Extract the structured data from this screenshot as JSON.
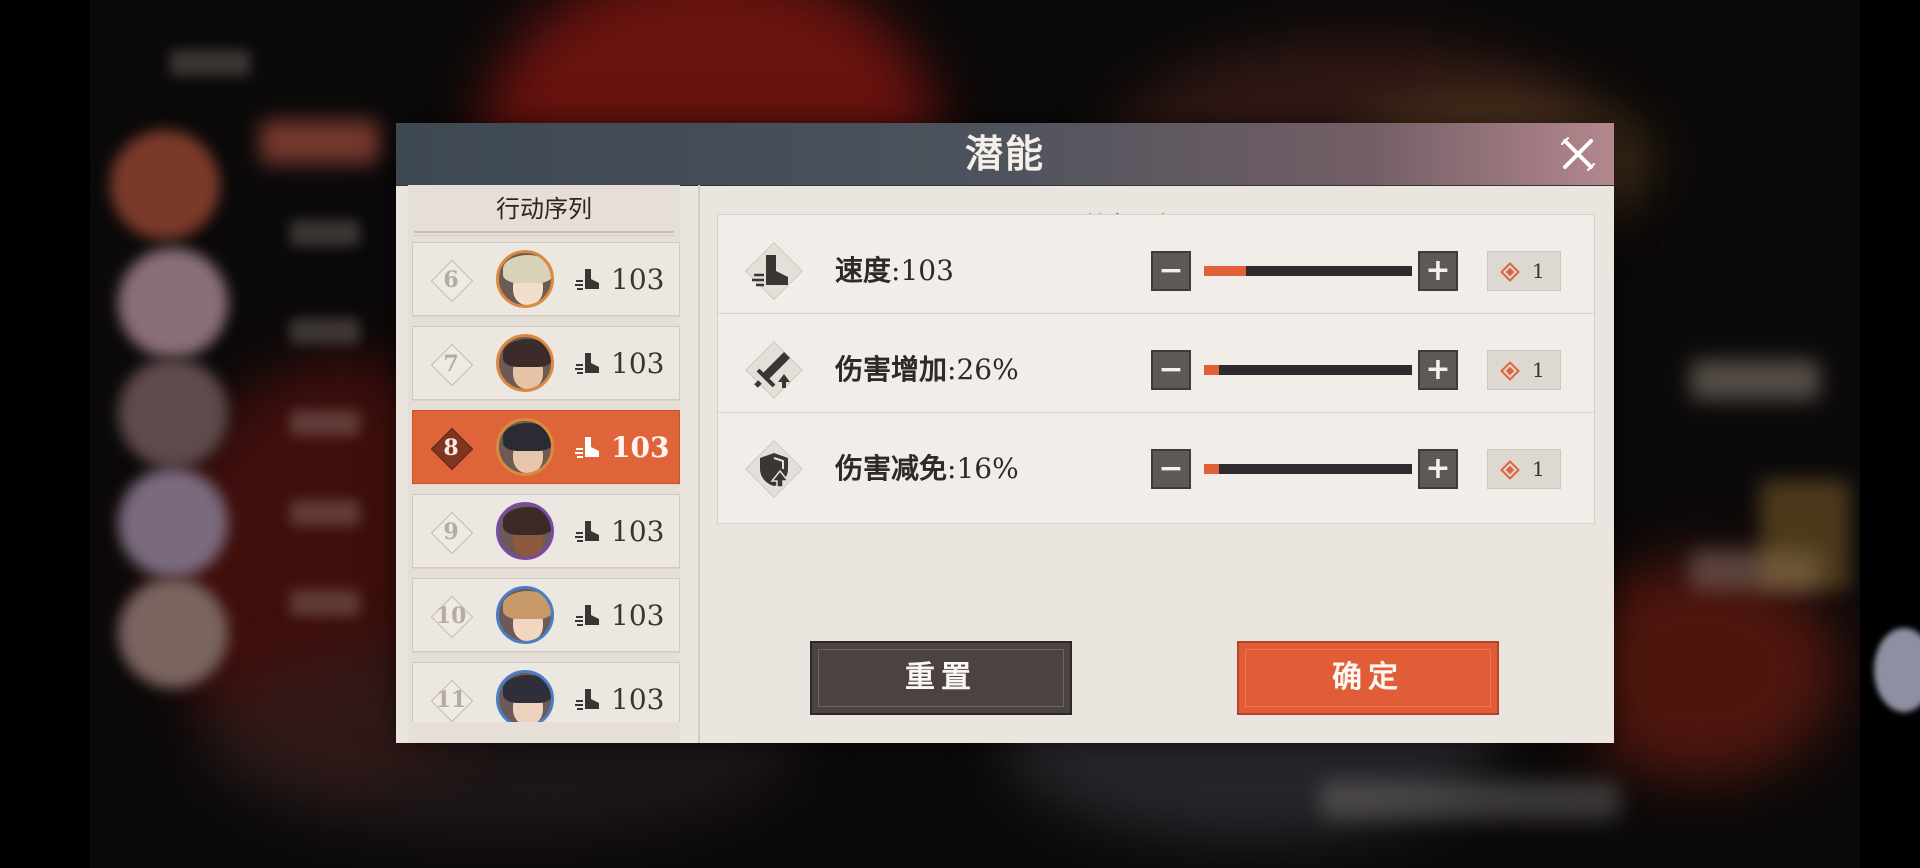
{
  "dialog": {
    "title": "潜能",
    "close_icon": "close-x-icon"
  },
  "sequence": {
    "title": "行动序列",
    "items": [
      {
        "order": "6",
        "speed": "103",
        "active": false,
        "hair": "#d8d2b8",
        "face": "#f2dccb",
        "ring": "#d98a3e"
      },
      {
        "order": "7",
        "speed": "103",
        "active": false,
        "hair": "#3b2b2a",
        "face": "#e6c2a6",
        "ring": "#d98a3e"
      },
      {
        "order": "8",
        "speed": "103",
        "active": true,
        "hair": "#2a2b33",
        "face": "#e7c6ab",
        "ring": "#d98a3e"
      },
      {
        "order": "9",
        "speed": "103",
        "active": false,
        "hair": "#3c2a28",
        "face": "#8d5a3e",
        "ring": "#7a4aa8"
      },
      {
        "order": "10",
        "speed": "103",
        "active": false,
        "hair": "#c79a6a",
        "face": "#f2d6c0",
        "ring": "#4a7dc4"
      },
      {
        "order": "11",
        "speed": "103",
        "active": false,
        "hair": "#2f2f3a",
        "face": "#ecd2bd",
        "ring": "#4a7dc4"
      }
    ]
  },
  "remaining": {
    "label": "剩余",
    "sep": "：",
    "value": "0",
    "icon": "potential-diamond-icon"
  },
  "stats": [
    {
      "name": "速度",
      "sep": ":",
      "value": "103",
      "level": 0.2,
      "cost": "1",
      "icon": "speed-boot-icon"
    },
    {
      "name": "伤害增加",
      "sep": ":",
      "value": "26%",
      "level": 0.07,
      "cost": "1",
      "icon": "damage-sword-up-icon"
    },
    {
      "name": "伤害减免",
      "sep": ":",
      "value": "16%",
      "level": 0.07,
      "cost": "1",
      "icon": "shield-up-icon"
    }
  ],
  "buttons": {
    "minus": "−",
    "plus": "+",
    "reset": "重置",
    "confirm": "确定"
  },
  "colors": {
    "accent": "#e0643a",
    "header": "#3e4851",
    "track": "#2d2b2b"
  }
}
